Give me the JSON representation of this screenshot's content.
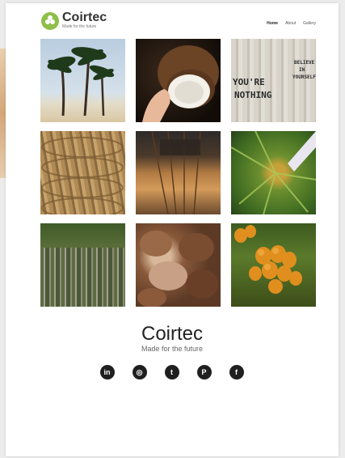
{
  "header": {
    "brand_name": "Coirtec",
    "brand_tagline": "Made for the future",
    "nav": [
      "Home",
      "About",
      "Gallery"
    ]
  },
  "gallery": {
    "tiles": [
      {
        "icon": "palm-beach-photo"
      },
      {
        "icon": "coconut-half-photo"
      },
      {
        "icon": "bark-carving-photo",
        "carving": [
          "YOU'RE",
          "NOTHING",
          "BELIEVE",
          "IN",
          "YOURSELF"
        ]
      },
      {
        "icon": "coir-rope-photo"
      },
      {
        "icon": "bamboo-weaving-photo"
      },
      {
        "icon": "palm-frond-photo"
      },
      {
        "icon": "palm-plantation-photo"
      },
      {
        "icon": "coconut-husks-photo"
      },
      {
        "icon": "orange-coconuts-photo"
      }
    ]
  },
  "footer": {
    "brand_name": "Coirtec",
    "tagline": "Made for the future",
    "socials": [
      {
        "name": "linkedin",
        "glyph": "in"
      },
      {
        "name": "instagram",
        "glyph": "◎"
      },
      {
        "name": "twitter",
        "glyph": "t"
      },
      {
        "name": "pinterest",
        "glyph": "P"
      },
      {
        "name": "facebook",
        "glyph": "f"
      }
    ]
  },
  "colors": {
    "accent": "#8fbf4a",
    "text": "#222222",
    "background": "#ffffff"
  }
}
